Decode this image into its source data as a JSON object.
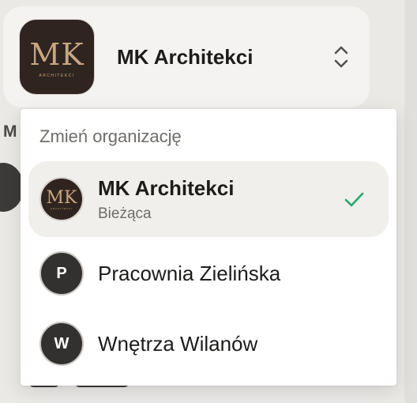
{
  "switcher": {
    "title": "MK Architekci",
    "logo_mark": "MK",
    "logo_sub": "ARCHITEKCI",
    "chevron_icon": "chevron-up-down-icon"
  },
  "background": {
    "section_letter": "M"
  },
  "dropdown": {
    "header": "Zmień organizację",
    "items": [
      {
        "name": "MK Architekci",
        "subtitle": "Bieżąca",
        "avatar_mark": "MK",
        "avatar_sub": "ARCHITEKCI",
        "current": true,
        "check_icon": "checkmark-icon"
      },
      {
        "name": "Pracownia Zielińska",
        "avatar_letter": "P",
        "current": false
      },
      {
        "name": "Wnętrza Wilanów",
        "avatar_letter": "W",
        "current": false
      }
    ]
  },
  "colors": {
    "accent_check": "#2aa86b",
    "avatar_bg": "#333130",
    "logo_bg": "#2f2420",
    "logo_gold": "#c7a680",
    "current_item_bg": "#f1efeb"
  }
}
